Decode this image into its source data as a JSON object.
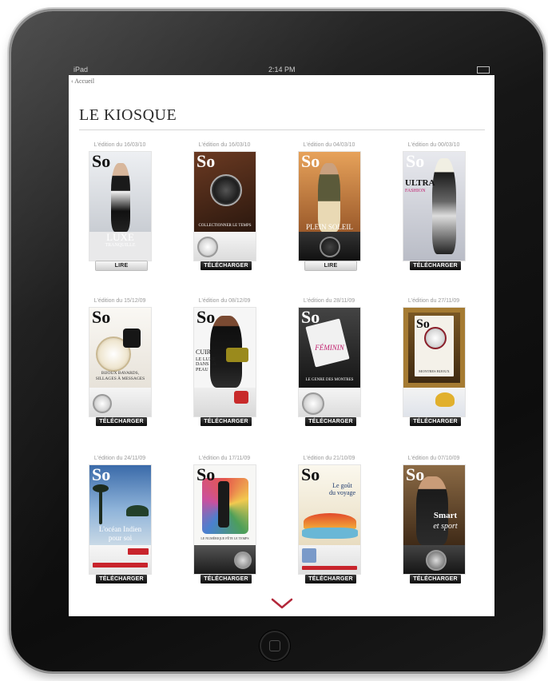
{
  "status": {
    "carrier": "iPad",
    "time": "2:14 PM"
  },
  "nav": {
    "back_label": "‹ Accueil"
  },
  "page": {
    "title": "LE KIOSQUE"
  },
  "issues": [
    {
      "date": "L'édition du 16/03/10",
      "action": "LIRE",
      "kind": "read",
      "cover_text": "LUXE",
      "cover_subtext": "TRANQUILLE"
    },
    {
      "date": "L'édition du 16/03/10",
      "action": "TÉLÉCHARGER",
      "kind": "download",
      "cover_text": "COLLECTIONNER LE TEMPS",
      "cover_subtext": ""
    },
    {
      "date": "L'édition du 04/03/10",
      "action": "LIRE",
      "kind": "read",
      "cover_text": "PLEIN SOLEIL",
      "cover_subtext": ""
    },
    {
      "date": "L'édition du 00/03/10",
      "action": "TÉLÉCHARGER",
      "kind": "download",
      "cover_text": "ULTRA",
      "cover_subtext": "FASHION"
    },
    {
      "date": "L'édition du 15/12/09",
      "action": "TÉLÉCHARGER",
      "kind": "download",
      "cover_text": "BIJOUX BAVARDS,",
      "cover_subtext": "SILLAGES À MESSAGES"
    },
    {
      "date": "L'édition du 08/12/09",
      "action": "TÉLÉCHARGER",
      "kind": "download",
      "cover_text": "CUIR",
      "cover_subtext": "LE LUXE DANS LA PEAU"
    },
    {
      "date": "L'édition du 28/11/09",
      "action": "TÉLÉCHARGER",
      "kind": "download",
      "cover_text": "FÉMININ",
      "cover_subtext": "LE GENRE DES MONTRES"
    },
    {
      "date": "L'édition du 27/11/09",
      "action": "TÉLÉCHARGER",
      "kind": "download",
      "cover_text": "MONTRES BIJOUX",
      "cover_subtext": ""
    },
    {
      "date": "L'édition du 24/11/09",
      "action": "TÉLÉCHARGER",
      "kind": "download",
      "cover_text": "L'océan Indien",
      "cover_subtext": "pour soi"
    },
    {
      "date": "L'édition du 17/11/09",
      "action": "TÉLÉCHARGER",
      "kind": "download",
      "cover_text": "LE NUMÉRIQUE FÊTE LE TEMPS",
      "cover_subtext": ""
    },
    {
      "date": "L'édition du 21/10/09",
      "action": "TÉLÉCHARGER",
      "kind": "download",
      "cover_text": "Le goût",
      "cover_subtext": "du voyage"
    },
    {
      "date": "L'édition du 07/10/09",
      "action": "TÉLÉCHARGER",
      "kind": "download",
      "cover_text": "Smart",
      "cover_subtext": "et sport"
    }
  ],
  "covers": {
    "logo": "So"
  },
  "colors": {
    "accent": "#b3283a",
    "download_button": "#111111",
    "read_button": "#e6e6e6"
  }
}
